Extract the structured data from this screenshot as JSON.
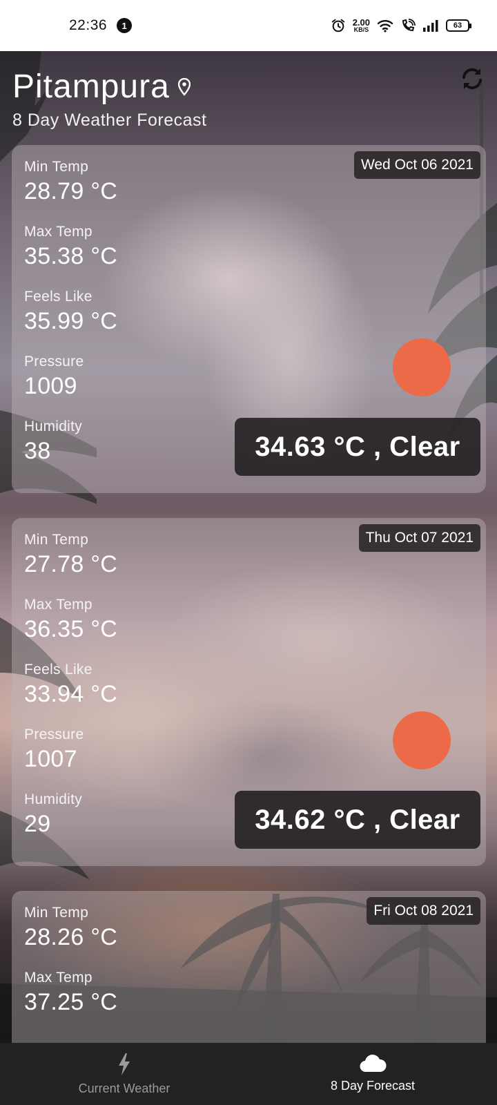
{
  "status_bar": {
    "time": "22:36",
    "notification_count": "1",
    "net_speed_value": "2.00",
    "net_speed_unit": "KB/S",
    "battery": "63"
  },
  "header": {
    "city": "Pitampura",
    "subtitle": "8 Day Weather Forecast"
  },
  "forecast": [
    {
      "date": "Wed Oct 06 2021",
      "min_temp_label": "Min Temp",
      "min_temp": "28.79 °C",
      "max_temp_label": "Max Temp",
      "max_temp": "35.38 °C",
      "feels_like_label": "Feels Like",
      "feels_like": "35.99 °C",
      "pressure_label": "Pressure",
      "pressure": "1009",
      "humidity_label": "Humidity",
      "humidity": "38",
      "summary": "34.63 °C , Clear"
    },
    {
      "date": "Thu Oct 07 2021",
      "min_temp_label": "Min Temp",
      "min_temp": "27.78 °C",
      "max_temp_label": "Max Temp",
      "max_temp": "36.35 °C",
      "feels_like_label": "Feels Like",
      "feels_like": "33.94 °C",
      "pressure_label": "Pressure",
      "pressure": "1007",
      "humidity_label": "Humidity",
      "humidity": "29",
      "summary": "34.62 °C , Clear"
    },
    {
      "date": "Fri Oct 08 2021",
      "min_temp_label": "Min Temp",
      "min_temp": "28.26 °C",
      "max_temp_label": "Max Temp",
      "max_temp": "37.25 °C"
    }
  ],
  "bottom_nav": {
    "items": [
      {
        "label": "Current Weather",
        "icon": "lightning-icon",
        "active": false
      },
      {
        "label": "8 Day Forecast",
        "icon": "cloud-icon",
        "active": true
      }
    ]
  },
  "colors": {
    "sun": "#ec6a48",
    "nav_background": "#222222",
    "chip_background": "#282426"
  }
}
